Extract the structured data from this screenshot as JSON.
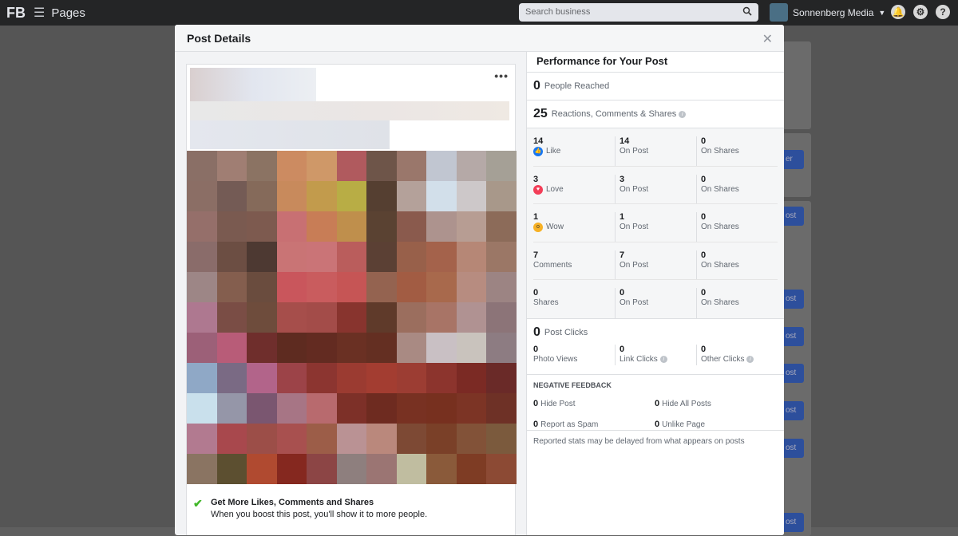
{
  "topbar": {
    "logo": "FB",
    "menu_icon": "hamburger-icon",
    "section": "Pages",
    "search_placeholder": "Search business",
    "business_name": "Sonnenberg Media"
  },
  "background_buttons": [
    "er",
    "ost",
    "ost",
    "ost",
    "ost",
    "ost",
    "ost",
    "ost"
  ],
  "modal": {
    "title": "Post Details"
  },
  "post": {
    "more_icon": "more-dots-icon",
    "promo_title": "Get More Likes, Comments and Shares",
    "promo_sub": "When you boost this post, you'll show it to more people."
  },
  "performance": {
    "title": "Performance for Your Post",
    "reached": {
      "value": "0",
      "label": "People Reached"
    },
    "engagement": {
      "value": "25",
      "label": "Reactions, Comments & Shares"
    },
    "rows": [
      {
        "total": "14",
        "name": "Like",
        "icon": "like-icon",
        "on_post": "14",
        "on_post_label": "On Post",
        "on_shares": "0",
        "on_shares_label": "On Shares"
      },
      {
        "total": "3",
        "name": "Love",
        "icon": "love-icon",
        "on_post": "3",
        "on_post_label": "On Post",
        "on_shares": "0",
        "on_shares_label": "On Shares"
      },
      {
        "total": "1",
        "name": "Wow",
        "icon": "wow-icon",
        "on_post": "1",
        "on_post_label": "On Post",
        "on_shares": "0",
        "on_shares_label": "On Shares"
      },
      {
        "total": "7",
        "name": "Comments",
        "on_post": "7",
        "on_post_label": "On Post",
        "on_shares": "0",
        "on_shares_label": "On Shares"
      },
      {
        "total": "0",
        "name": "Shares",
        "on_post": "0",
        "on_post_label": "On Post",
        "on_shares": "0",
        "on_shares_label": "On Shares"
      }
    ],
    "clicks": {
      "value": "0",
      "label": "Post Clicks",
      "photo_views": "0",
      "photo_views_label": "Photo Views",
      "link_clicks": "0",
      "link_clicks_label": "Link Clicks",
      "other_clicks": "0",
      "other_clicks_label": "Other Clicks"
    },
    "negative": {
      "title": "NEGATIVE FEEDBACK",
      "hide_post": "0",
      "hide_post_label": "Hide Post",
      "hide_all": "0",
      "hide_all_label": "Hide All Posts",
      "spam": "0",
      "spam_label": "Report as Spam",
      "unlike": "0",
      "unlike_label": "Unlike Page"
    },
    "note": "Reported stats may be delayed from what appears on posts"
  },
  "colors": {
    "accent": "#1877f2",
    "topbar": "#242526"
  }
}
